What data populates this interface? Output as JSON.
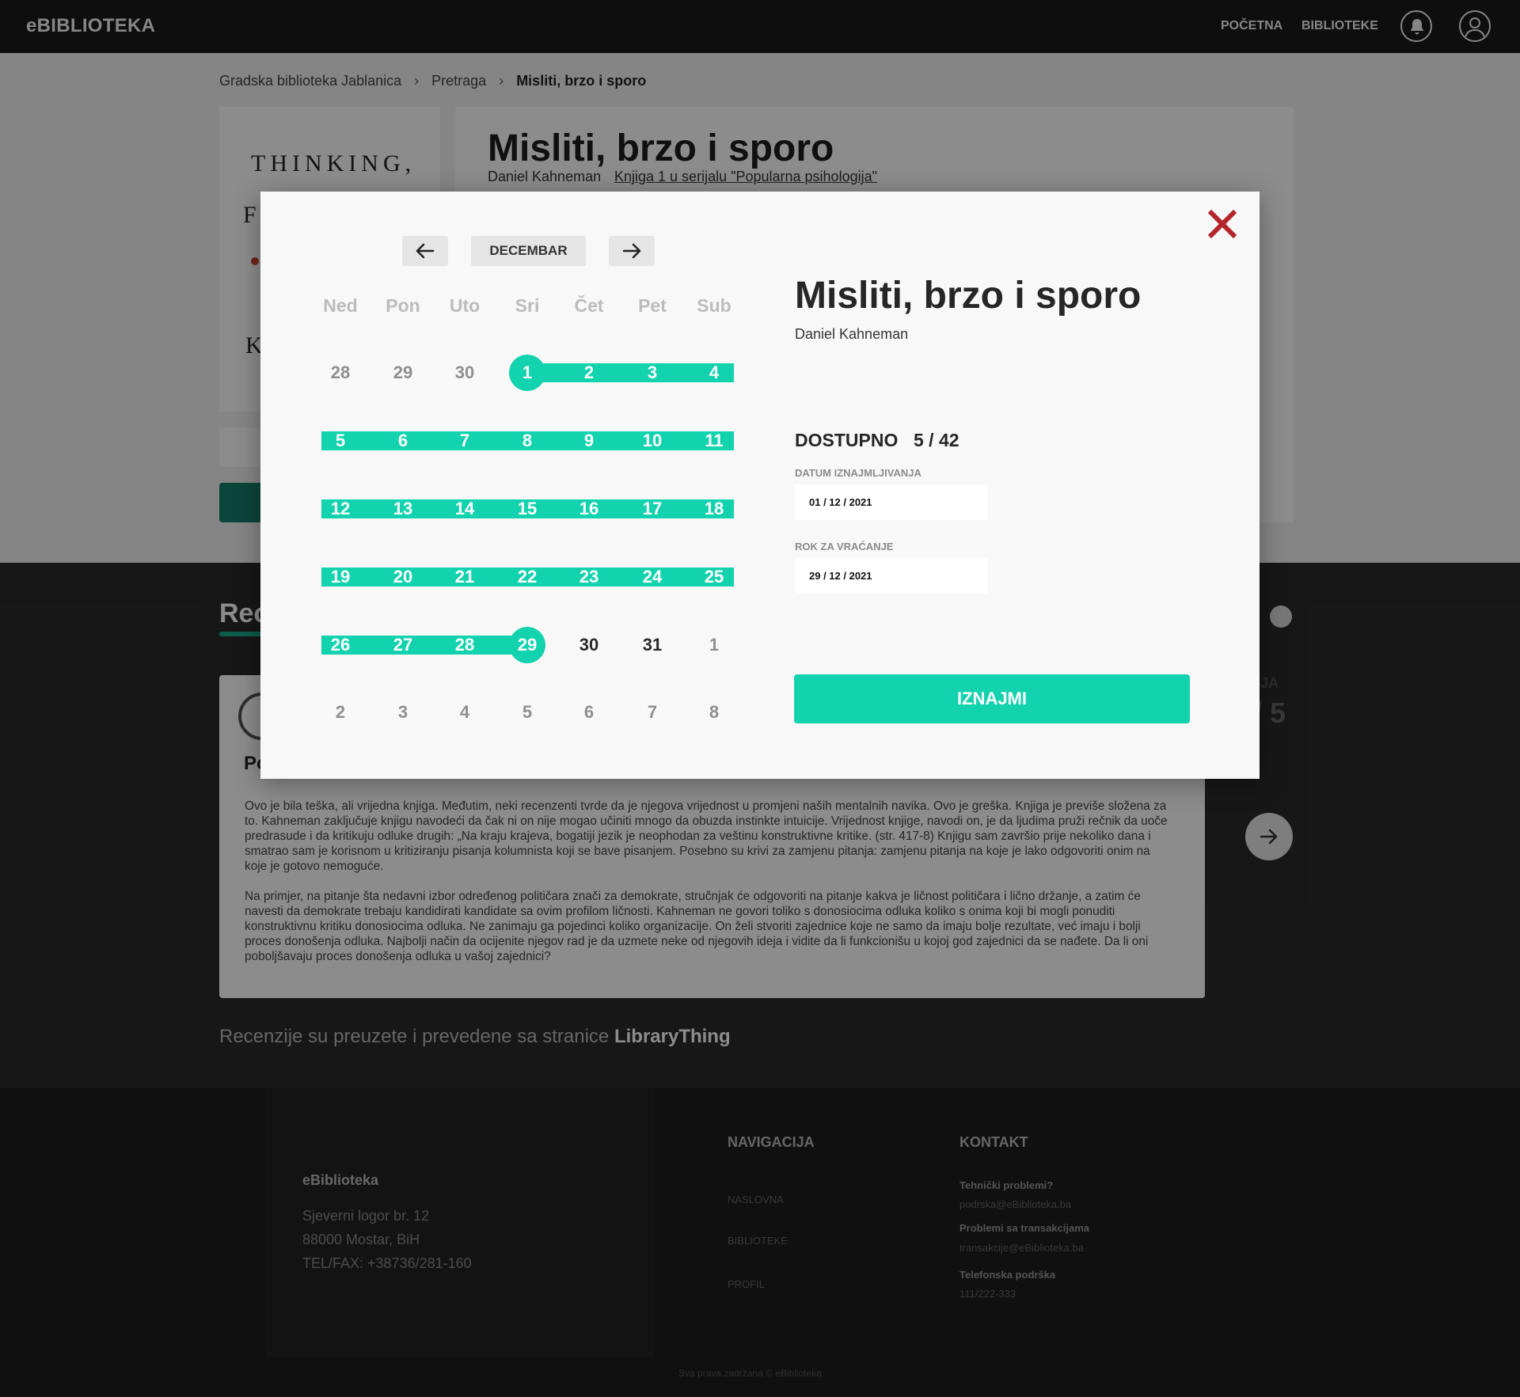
{
  "header": {
    "logo": "eBIBLIOTEKA",
    "nav": [
      {
        "label": "POČETNA"
      },
      {
        "label": "BIBLIOTEKE"
      }
    ],
    "icons": [
      "bell-icon",
      "user-icon"
    ]
  },
  "breadcrumb": [
    {
      "label": "Gradska biblioteka Jablanica"
    },
    {
      "label": "Pretraga"
    },
    {
      "label": "Misliti, brzo i sporo"
    }
  ],
  "book": {
    "title": "Misliti, brzo i sporo",
    "author": "Daniel Kahneman",
    "series": "Knjiga 1 u serijalu \"Popularna psihologija\"",
    "cover_text": [
      "THINKING,",
      "F",
      "K"
    ]
  },
  "reviews": {
    "heading": "Rec",
    "rating_label": "ZIJA",
    "rating_value": "/ 5",
    "reviewer_initials": "Po",
    "text": [
      "Ovo je bila teška, ali vrijedna knjiga. Međutim, neki recenzenti tvrde da je njegova vrijednost u promjeni naših mentalnih navika. Ovo je greška. Knjiga je previše složena za to. Kahneman zaključuje knjigu navodeći da čak ni on nije mogao učiniti mnogo da obuzda instinkte intuicije. Vrijednost knjige, navodi on, je da ljudima pruži rečnik da uoče predrasude i da kritikuju odluke drugih: „Na kraju krajeva, bogatiji jezik je neophodan za veštinu konstruktivne kritike. (str. 417-8) Knjigu sam završio prije nekoliko dana i smatrao sam je korisnom u kritiziranju pisanja kolumnista koji se bave pisanjem. Posebno su krivi za zamjenu pitanja: zamjenu pitanja na koje je lako odgovoriti onim na koje je gotovo nemoguće.",
      "Na primjer, na pitanje šta nedavni izbor određenog političara znači za demokrate, stručnjak će odgovoriti na pitanje kakva je ličnost političara i lično držanje, a zatim će navesti da demokrate trebaju kandidirati kandidate sa ovim profilom ličnosti. Kahneman ne govori toliko s donosiocima odluka koliko s onima koji bi mogli ponuditi konstruktivnu kritiku donosiocima odluka. Ne zanimaju ga pojedinci koliko organizacije. On želi stvoriti zajednice koje ne samo da imaju bolje rezultate, već imaju i bolji proces donošenja odluka. Najbolji način da ocijenite njegov rad je da uzmete neke od njegovih ideja i vidite da li funkcionišu u kojoj god zajednici da se nađete. Da li oni poboljšavaju proces donošenja odluka u vašoj zajednici?"
    ],
    "source_prefix": "Recenzije su preuzete i prevedene sa stranice",
    "source_name": "LibraryThing"
  },
  "footer": {
    "brand": "eBiblioteka",
    "address": [
      "Sjeverni logor br. 12",
      "88000 Mostar, BiH",
      "TEL/FAX: +38736/281-160"
    ],
    "nav_heading": "NAVIGACIJA",
    "nav_links": [
      "NASLOVNA",
      "BIBLIOTEKE",
      "PROFIL"
    ],
    "contact_heading": "KONTAKT",
    "contacts": [
      {
        "title": "Tehnički problemi?",
        "value": "podrska@eBiblioteka.ba"
      },
      {
        "title": "Problemi sa transakcijama",
        "value": "transakcije@eBiblioteka.ba"
      },
      {
        "title": "Telefonska podrška",
        "value": "111/222-333"
      }
    ],
    "copyright": "Sva prava zadržana © eBiblioteka"
  },
  "modal": {
    "close_icon": "close-icon",
    "calendar": {
      "month": "DECEMBAR",
      "prev_icon": "arrow-left-icon",
      "next_icon": "arrow-right-icon",
      "weekdays": [
        "Ned",
        "Pon",
        "Uto",
        "Sri",
        "Čet",
        "Pet",
        "Sub"
      ],
      "weeks": [
        [
          {
            "d": "28",
            "s": "other"
          },
          {
            "d": "29",
            "s": "other"
          },
          {
            "d": "30",
            "s": "other"
          },
          {
            "d": "1",
            "s": "start"
          },
          {
            "d": "2",
            "s": "range"
          },
          {
            "d": "3",
            "s": "range"
          },
          {
            "d": "4",
            "s": "range"
          }
        ],
        [
          {
            "d": "5",
            "s": "range"
          },
          {
            "d": "6",
            "s": "range"
          },
          {
            "d": "7",
            "s": "range"
          },
          {
            "d": "8",
            "s": "range"
          },
          {
            "d": "9",
            "s": "range"
          },
          {
            "d": "10",
            "s": "range"
          },
          {
            "d": "11",
            "s": "range"
          }
        ],
        [
          {
            "d": "12",
            "s": "range"
          },
          {
            "d": "13",
            "s": "range"
          },
          {
            "d": "14",
            "s": "range"
          },
          {
            "d": "15",
            "s": "range"
          },
          {
            "d": "16",
            "s": "range"
          },
          {
            "d": "17",
            "s": "range"
          },
          {
            "d": "18",
            "s": "range"
          }
        ],
        [
          {
            "d": "19",
            "s": "range"
          },
          {
            "d": "20",
            "s": "range"
          },
          {
            "d": "21",
            "s": "range"
          },
          {
            "d": "22",
            "s": "range"
          },
          {
            "d": "23",
            "s": "range"
          },
          {
            "d": "24",
            "s": "range"
          },
          {
            "d": "25",
            "s": "range"
          }
        ],
        [
          {
            "d": "26",
            "s": "range"
          },
          {
            "d": "27",
            "s": "range"
          },
          {
            "d": "28",
            "s": "range"
          },
          {
            "d": "29",
            "s": "end"
          },
          {
            "d": "30",
            "s": "current"
          },
          {
            "d": "31",
            "s": "current"
          },
          {
            "d": "1",
            "s": "other"
          }
        ],
        [
          {
            "d": "2",
            "s": "other"
          },
          {
            "d": "3",
            "s": "other"
          },
          {
            "d": "4",
            "s": "other"
          },
          {
            "d": "5",
            "s": "other"
          },
          {
            "d": "6",
            "s": "other"
          },
          {
            "d": "7",
            "s": "other"
          },
          {
            "d": "8",
            "s": "other"
          }
        ]
      ]
    },
    "title": "Misliti, brzo i sporo",
    "author": "Daniel Kahneman",
    "availability_label": "DOSTUPNO",
    "availability_value": "5 / 42",
    "rent_date_label": "DATUM IZNAJMLJIVANJA",
    "rent_date_value": "01 / 12 / 2021",
    "return_date_label": "ROK ZA VRAĆANJE",
    "return_date_value": "29 / 12 / 2021",
    "submit_label": "IZNAJMI"
  },
  "colors": {
    "accent": "#13d3ae",
    "close": "#b3262b",
    "modal_bg": "#f8f8f8",
    "dark_bg": "#2b2b2b"
  }
}
